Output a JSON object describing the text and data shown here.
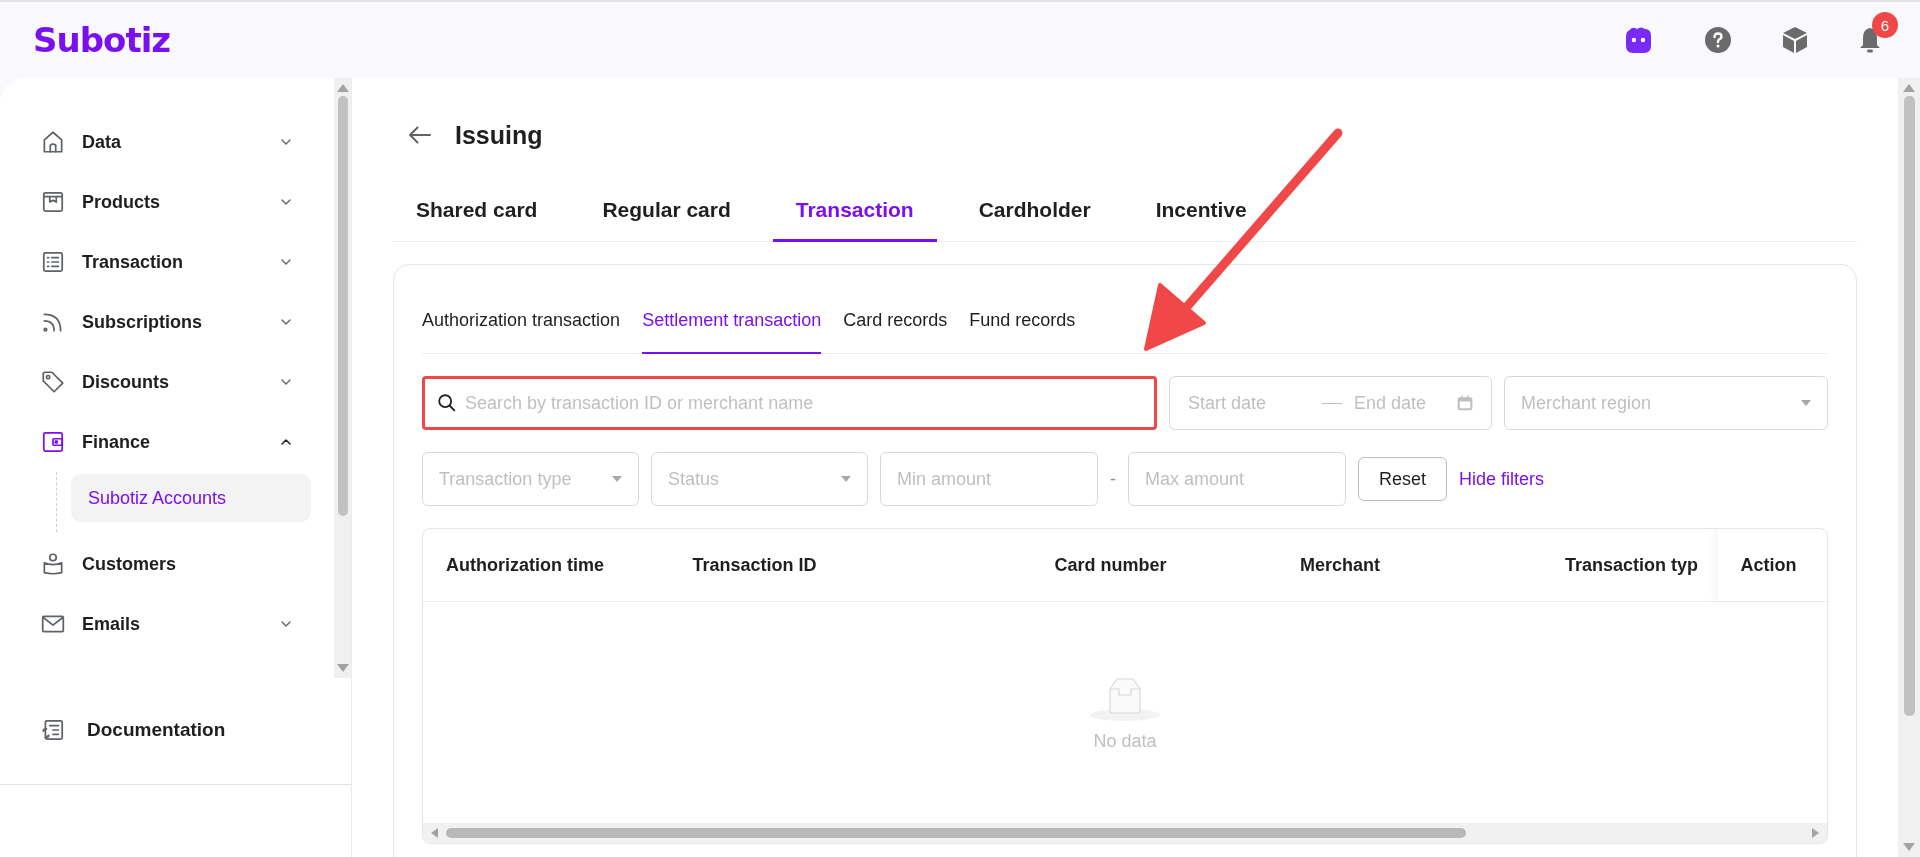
{
  "header": {
    "logo": "Subotiz",
    "notification_count": "6"
  },
  "sidebar": {
    "items": [
      {
        "label": "Data",
        "kind": "group",
        "expanded": false
      },
      {
        "label": "Products",
        "kind": "group",
        "expanded": false
      },
      {
        "label": "Transaction",
        "kind": "group",
        "expanded": false
      },
      {
        "label": "Subscriptions",
        "kind": "group",
        "expanded": false
      },
      {
        "label": "Discounts",
        "kind": "group",
        "expanded": false
      },
      {
        "label": "Finance",
        "kind": "group",
        "expanded": true,
        "children": [
          {
            "label": "Subotiz Accounts",
            "selected": true
          }
        ]
      },
      {
        "label": "Customers",
        "kind": "link"
      },
      {
        "label": "Emails",
        "kind": "group",
        "expanded": false
      }
    ],
    "footer_item": "Documentation"
  },
  "main": {
    "title": "Issuing",
    "tabs": [
      {
        "label": "Shared card",
        "selected": false
      },
      {
        "label": "Regular card",
        "selected": false
      },
      {
        "label": "Transaction",
        "selected": true
      },
      {
        "label": "Cardholder",
        "selected": false
      },
      {
        "label": "Incentive",
        "selected": false
      }
    ],
    "subtabs": [
      {
        "label": "Authorization transaction",
        "selected": false
      },
      {
        "label": "Settlement transaction",
        "selected": true
      },
      {
        "label": "Card records",
        "selected": false
      },
      {
        "label": "Fund records",
        "selected": false
      }
    ],
    "filters": {
      "search": {
        "placeholder": "Search by transaction ID or merchant name",
        "highlighted": true
      },
      "start_date": {
        "placeholder": "Start date"
      },
      "end_date": {
        "placeholder": "End date"
      },
      "merchant_region": {
        "placeholder": "Merchant region"
      },
      "transaction_type": {
        "placeholder": "Transaction type"
      },
      "status": {
        "placeholder": "Status"
      },
      "min_amount": {
        "placeholder": "Min amount"
      },
      "range_separator": "-",
      "max_amount": {
        "placeholder": "Max amount"
      },
      "reset": "Reset",
      "toggle": "Hide filters"
    },
    "table": {
      "columns": [
        "Authorization time",
        "Transaction ID",
        "Card number",
        "Merchant",
        "Transaction typ",
        "Action"
      ],
      "empty_text": "No data"
    }
  },
  "annotation_arrow": true
}
